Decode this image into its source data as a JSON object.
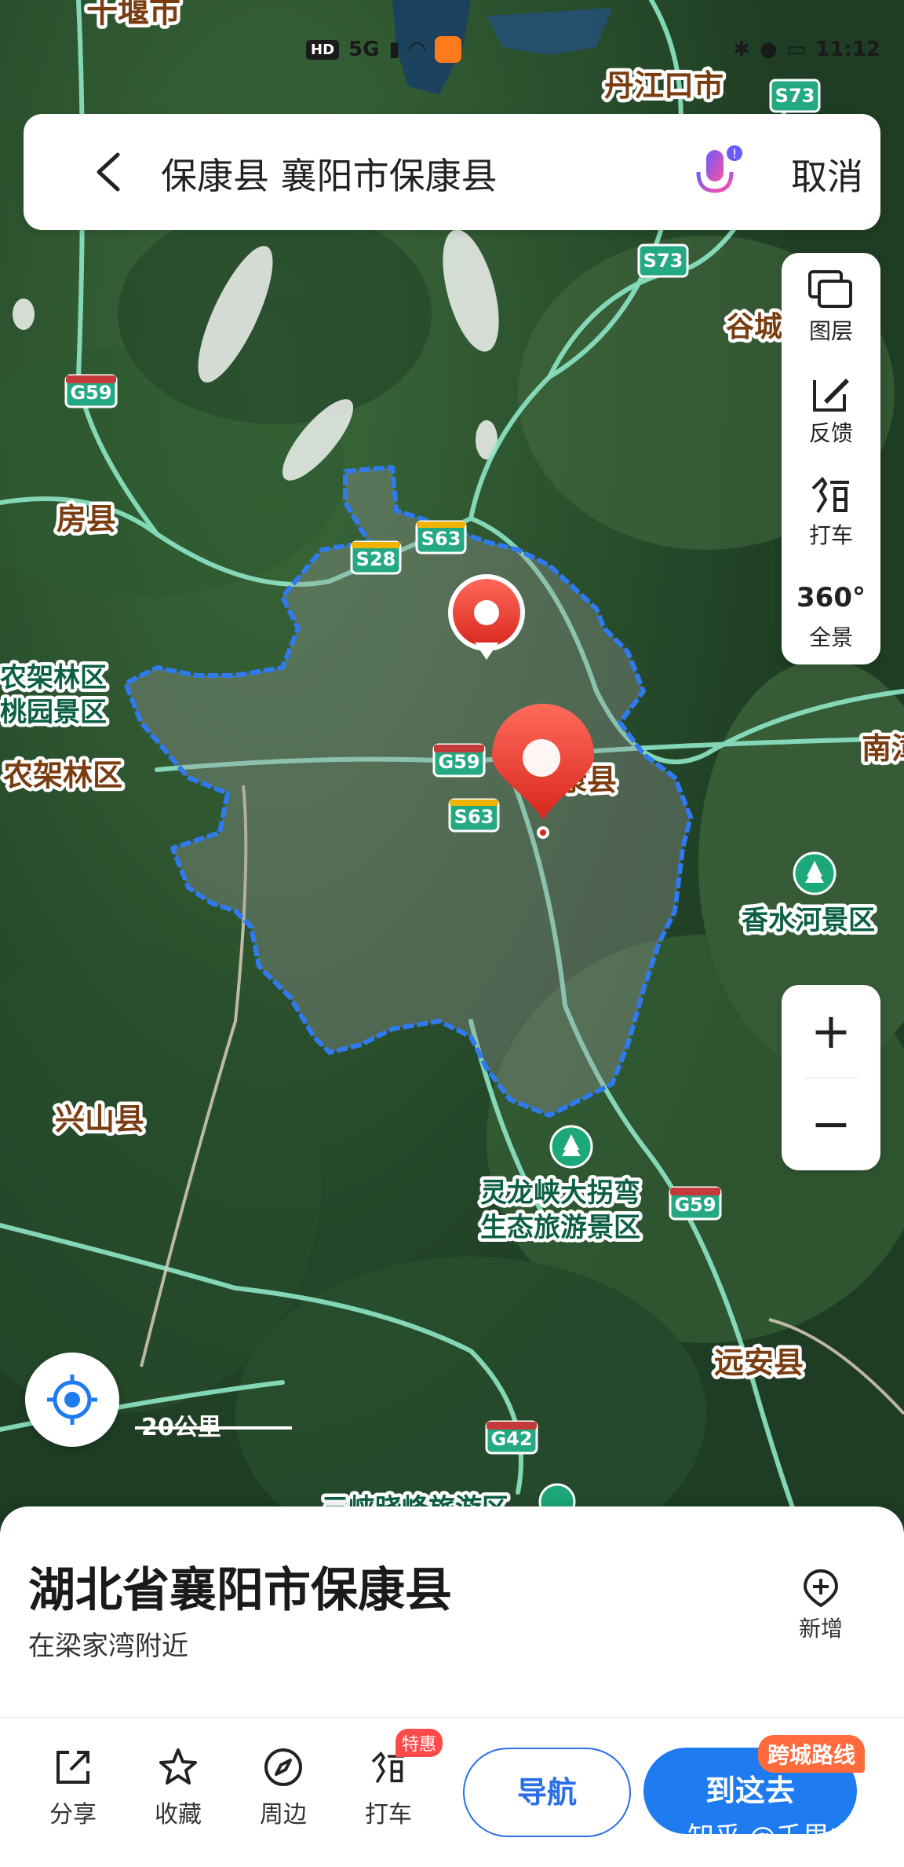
{
  "status_bar": {
    "hd": "HD",
    "signal": "5G",
    "time": "11:12"
  },
  "search": {
    "query": "保康县 襄阳市保康县",
    "cancel_label": "取消"
  },
  "tools": [
    {
      "label": "图层",
      "icon": "layers-icon"
    },
    {
      "label": "反馈",
      "icon": "edit-feedback-icon"
    },
    {
      "label": "打车",
      "icon": "taxi-icon"
    },
    {
      "label": "全景",
      "icon": "panorama-360-icon"
    }
  ],
  "tools_360_text": "360°",
  "zoom": {
    "in": "+",
    "out": "−"
  },
  "scale": {
    "label": "20公里"
  },
  "map": {
    "places": {
      "shiyan": "十堰市",
      "danjiangkou": "丹江口市",
      "gucheng": "谷城",
      "fangxian": "房县",
      "baokang": "保康县",
      "shennongjia1": "农架林区",
      "taoyuan": "桃园景区",
      "shennongjia2": "农架林区",
      "nanzhang": "南漳",
      "xiangshuihe": "香水河景区",
      "xingshan": "兴山县",
      "linglongxia_1": "灵龙峡大拐弯",
      "linglongxia_2": "生态旅游景区",
      "yuanan": "远安县",
      "sanxia": "三峡晓峰旅游区",
      "top_poi": "…景区"
    },
    "highways": {
      "s73a": "S73",
      "s73b": "S73",
      "g59a": "G59",
      "s28": "S28",
      "s63a": "S63",
      "g59b": "G59",
      "s63b": "S63",
      "g59c": "G59",
      "g42": "G42"
    }
  },
  "info_panel": {
    "title": "湖北省襄阳市保康县",
    "subtitle": "在梁家湾附近",
    "add_label": "新增"
  },
  "actions": {
    "share": "分享",
    "favorite": "收藏",
    "nearby": "周边",
    "taxi": "打车",
    "taxi_badge": "特惠",
    "navigate": "导航",
    "go_here": "到这去",
    "go_badge": "跨城路线"
  },
  "watermark": "知乎 @千里之行",
  "colors": {
    "accent": "#1f7bf0",
    "boundary": "#2f7af0",
    "pin": "#e53935",
    "road": "#8ee6c6"
  }
}
